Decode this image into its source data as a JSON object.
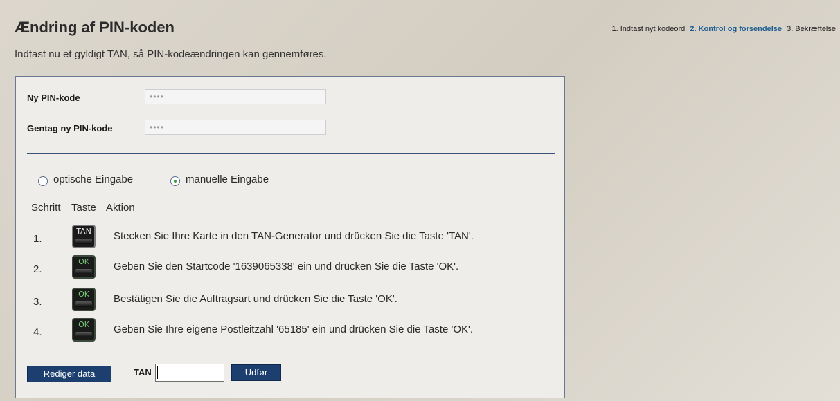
{
  "header": {
    "title": "Ændring af PIN-koden",
    "steps": [
      {
        "label": "1. Indtast nyt kodeord",
        "active": false
      },
      {
        "label": "2. Kontrol og forsendelse",
        "active": true
      },
      {
        "label": "3. Bekræftelse",
        "active": false
      }
    ]
  },
  "intro": "Indtast nu et gyldigt TAN, så PIN-kodeændringen kan gennemføres.",
  "form": {
    "new_pin_label": "Ny PIN-kode",
    "new_pin_value": "••••",
    "repeat_pin_label": "Gentag ny PIN-kode",
    "repeat_pin_value": "••••"
  },
  "input_mode": {
    "options": [
      {
        "label": "optische Eingabe",
        "checked": false
      },
      {
        "label": "manuelle Eingabe",
        "checked": true
      }
    ]
  },
  "table": {
    "headers": {
      "step": "Schritt",
      "key": "Taste",
      "action": "Aktion"
    },
    "rows": [
      {
        "step": "1.",
        "key": "TAN",
        "action": "Stecken Sie Ihre Karte in den TAN-Generator und drücken Sie die Taste 'TAN'."
      },
      {
        "step": "2.",
        "key": "OK",
        "action": "Geben Sie den Startcode '1639065338' ein und drücken Sie die Taste 'OK'."
      },
      {
        "step": "3.",
        "key": "OK",
        "action": "Bestätigen Sie die Auftragsart und drücken Sie die Taste 'OK'."
      },
      {
        "step": "4.",
        "key": "OK",
        "action": "Geben Sie Ihre eigene Postleitzahl '65185' ein und drücken Sie die Taste 'OK'."
      }
    ]
  },
  "footer": {
    "edit_button": "Rediger data",
    "tan_label": "TAN",
    "tan_value": "",
    "submit_button": "Udfør"
  },
  "colors": {
    "accent": "#1d3f6f",
    "active_step": "#1e5d92"
  }
}
